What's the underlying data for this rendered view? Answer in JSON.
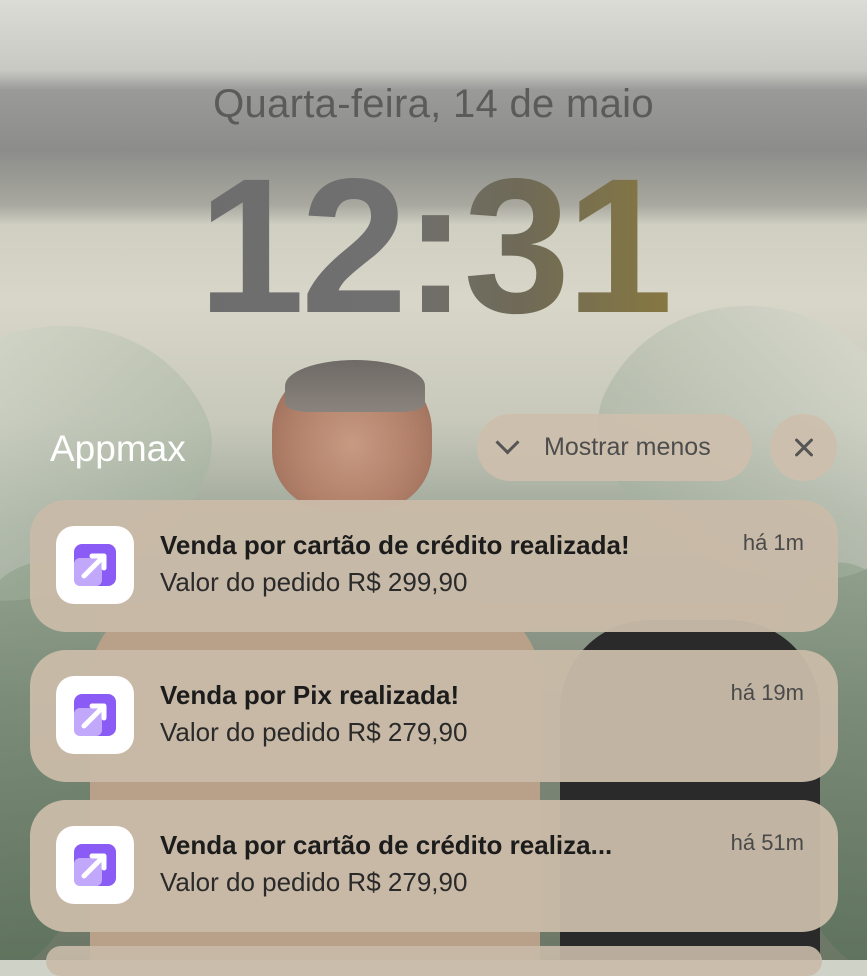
{
  "lockscreen": {
    "date": "Quarta-feira, 14 de maio",
    "time": "12:31"
  },
  "group": {
    "app_name": "Appmax",
    "show_less_label": "Mostrar menos",
    "close_icon": "close-icon",
    "chevron_icon": "chevron-down-icon"
  },
  "colors": {
    "icon_purple": "#8a5cf5",
    "icon_purple_light": "#b59af7",
    "card_bg": "#c9baa8"
  },
  "notifications": [
    {
      "app_icon": "appmax-icon",
      "title": "Venda por cartão de crédito realizada!",
      "body": "Valor do pedido R$ 299,90",
      "time_ago": "há 1m"
    },
    {
      "app_icon": "appmax-icon",
      "title": "Venda por Pix realizada!",
      "body": "Valor do pedido R$ 279,90",
      "time_ago": "há 19m"
    },
    {
      "app_icon": "appmax-icon",
      "title": "Venda por cartão de crédito realiza...",
      "body": "Valor do pedido R$ 279,90",
      "time_ago": "há 51m"
    }
  ]
}
